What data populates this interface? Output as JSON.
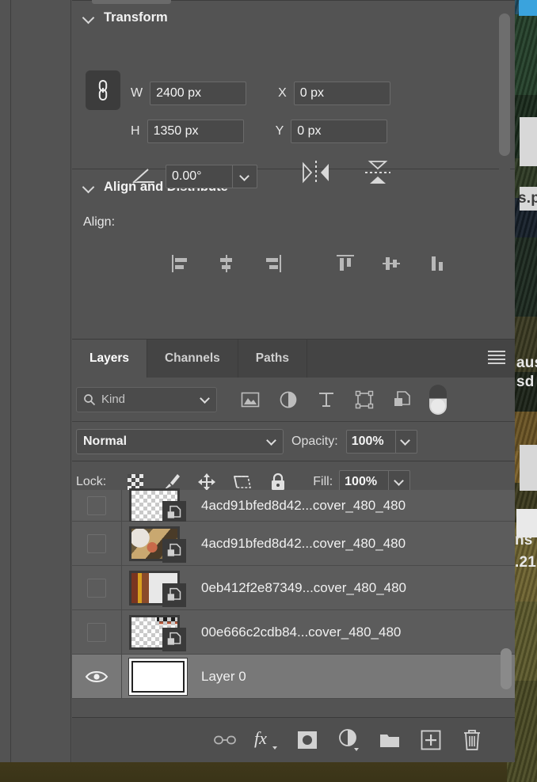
{
  "panels": {
    "transform": {
      "title": "Transform",
      "chevron_icon": "chevron-down-icon",
      "link_icon": "link-chain-icon",
      "w_label": "W",
      "w_value": "2400 px",
      "x_label": "X",
      "x_value": "0 px",
      "h_label": "H",
      "h_value": "1350 px",
      "y_label": "Y",
      "y_value": "0 px",
      "angle_icon": "angle-icon",
      "angle_value": "0.00°",
      "angle_dropdown_icon": "chevron-down-icon",
      "flip_horizontal_icon": "flip-horizontal-icon",
      "flip_vertical_icon": "flip-vertical-icon"
    },
    "align": {
      "title": "Align and Distribute",
      "chevron_icon": "chevron-down-icon",
      "align_label": "Align:",
      "buttons": [
        {
          "name": "align-left-edges",
          "icon": "align-left-icon"
        },
        {
          "name": "align-horizontal-centers",
          "icon": "align-center-horizontal-icon"
        },
        {
          "name": "align-right-edges",
          "icon": "align-right-icon"
        },
        {
          "name": "align-top-edges",
          "icon": "align-top-icon"
        },
        {
          "name": "align-vertical-centers",
          "icon": "align-center-vertical-icon"
        },
        {
          "name": "align-bottom-edges",
          "icon": "align-bottom-icon"
        }
      ]
    },
    "layers": {
      "tabs": [
        {
          "label": "Layers",
          "active": true
        },
        {
          "label": "Channels",
          "active": false
        },
        {
          "label": "Paths",
          "active": false
        }
      ],
      "menu_icon": "panel-menu-icon",
      "filter": {
        "search_icon": "search-icon",
        "kind_label": "Kind",
        "dropdown_icon": "chevron-down-icon",
        "icons": [
          {
            "name": "filter-pixel-layers",
            "icon": "image-icon"
          },
          {
            "name": "filter-adjustment-layers",
            "icon": "adjustment-circle-icon"
          },
          {
            "name": "filter-type-layers",
            "icon": "text-type-icon"
          },
          {
            "name": "filter-shape-layers",
            "icon": "shape-bounding-box-icon"
          },
          {
            "name": "filter-smart-objects",
            "icon": "smart-object-icon"
          }
        ],
        "toggle_name": "filter-enable-toggle"
      },
      "blend": {
        "mode": "Normal",
        "mode_dropdown_icon": "chevron-down-icon",
        "opacity_label": "Opacity:",
        "opacity_value": "100%",
        "opacity_dropdown_icon": "chevron-down-icon"
      },
      "lock": {
        "label": "Lock:",
        "icons": [
          {
            "name": "lock-transparent-pixels",
            "icon": "checkerboard-icon"
          },
          {
            "name": "lock-image-pixels",
            "icon": "brush-icon"
          },
          {
            "name": "lock-position",
            "icon": "move-arrows-icon"
          },
          {
            "name": "lock-artboard-nesting",
            "icon": "artboard-icon"
          },
          {
            "name": "lock-all",
            "icon": "padlock-icon"
          }
        ],
        "fill_label": "Fill:",
        "fill_value": "100%",
        "fill_dropdown_icon": "chevron-down-icon"
      },
      "rows": [
        {
          "name": "4acd91bfed8d42...cover_480_480",
          "visible": false,
          "selected": false,
          "thumb": "transparent",
          "smart_object": true
        },
        {
          "name": "4acd91bfed8d42...cover_480_480",
          "visible": false,
          "selected": false,
          "thumb": "photo-food",
          "smart_object": true
        },
        {
          "name": "0eb412f2e87349...cover_480_480",
          "visible": false,
          "selected": false,
          "thumb": "photo-partial",
          "smart_object": true
        },
        {
          "name": "00e666c2cdb84...cover_480_480",
          "visible": false,
          "selected": false,
          "thumb": "transparent-partial",
          "smart_object": true
        },
        {
          "name": "Layer 0",
          "visible": true,
          "selected": true,
          "thumb": "white",
          "smart_object": false
        }
      ],
      "footer_buttons": [
        {
          "name": "link-layers-button",
          "icon": "chain-link-icon"
        },
        {
          "name": "layer-style-button",
          "icon": "fx-icon"
        },
        {
          "name": "layer-mask-button",
          "icon": "mask-icon"
        },
        {
          "name": "new-adjustment-layer-button",
          "icon": "adjustment-circle-icon"
        },
        {
          "name": "new-group-button",
          "icon": "folder-icon"
        },
        {
          "name": "new-layer-button",
          "icon": "plus-square-icon"
        },
        {
          "name": "delete-layer-button",
          "icon": "trash-icon"
        }
      ]
    }
  },
  "background_window": {
    "text_fragments": [
      "s.p",
      "aus",
      "sd",
      "ns",
      ".21"
    ]
  },
  "colors": {
    "panel_bg": "#535353",
    "panel_bg_dark": "#444444",
    "field_bg": "#4b4b4b",
    "row_bg": "#5c5c5c",
    "row_selected": "#787878",
    "text": "#f0f0f0",
    "text_dim": "#c6c6c6",
    "border": "#3b3b3b"
  }
}
